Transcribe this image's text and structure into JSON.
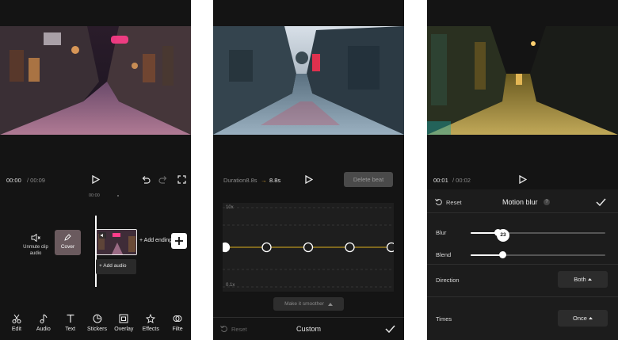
{
  "editor": {
    "time_current": "00:00",
    "time_total": "/ 00:09",
    "ruler_mark": "00:00",
    "unmute_label": "Unmute clip audio",
    "cover_label": "Cover",
    "add_ending_label": "+ Add ending",
    "add_audio_label": "+ Add audio",
    "toolbar": [
      {
        "label": "Edit",
        "icon": "scissors-icon"
      },
      {
        "label": "Audio",
        "icon": "music-note-icon"
      },
      {
        "label": "Text",
        "icon": "text-icon"
      },
      {
        "label": "Stickers",
        "icon": "sticker-icon"
      },
      {
        "label": "Overlay",
        "icon": "overlay-icon"
      },
      {
        "label": "Effects",
        "icon": "effects-icon"
      },
      {
        "label": "Filte",
        "icon": "filter-icon"
      }
    ]
  },
  "speed": {
    "duration_label": "Duration8.8s",
    "duration_arrow": "→",
    "duration_new": "8.8s",
    "delete_beat_label": "Delete beat",
    "max_label": "10x",
    "min_label": "0.1x",
    "smoother_label": "Make it smoother",
    "reset_label": "Reset",
    "title": "Custom",
    "curve_point_levels": [
      0.5,
      0.5,
      0.5,
      0.5,
      0.5
    ],
    "line_color": "#b8941f"
  },
  "motion_blur": {
    "time_current": "00:01",
    "time_total": "/ 00:02",
    "reset_label": "Reset",
    "title": "Motion blur",
    "help_symbol": "?",
    "blur_label": "Blur",
    "blur_value": "23",
    "blur_level": 0.2,
    "blend_label": "Blend",
    "blend_level": 0.24,
    "direction_label": "Direction",
    "direction_value": "Both",
    "times_label": "Times",
    "times_value": "Once"
  }
}
